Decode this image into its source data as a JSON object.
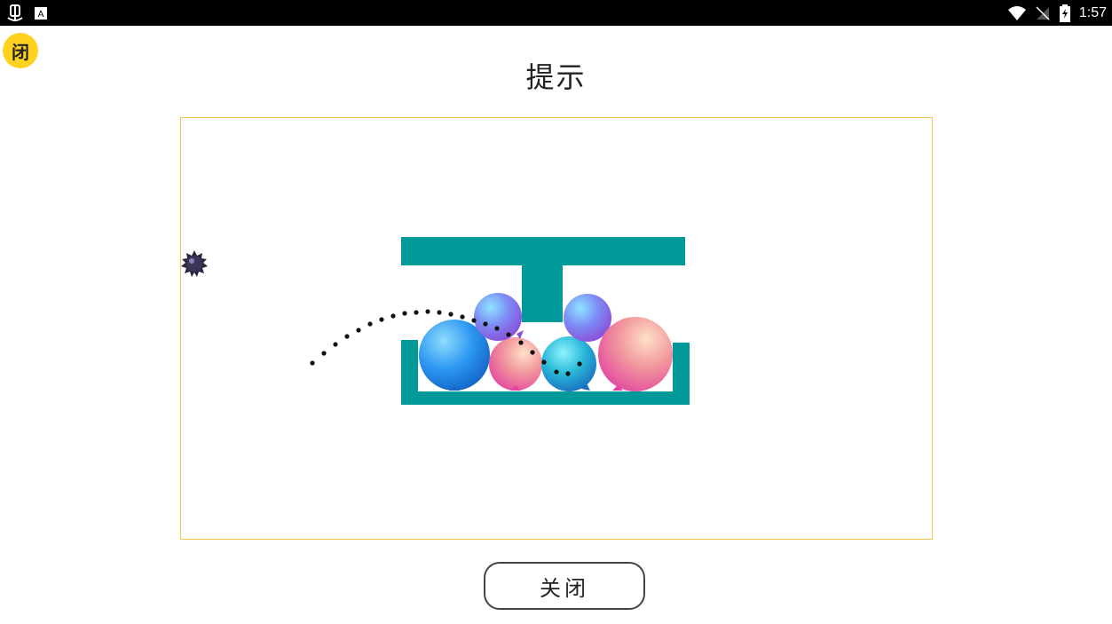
{
  "status_bar": {
    "time": "1:57",
    "left_icons": [
      "bug-icon",
      "a-notification-icon"
    ],
    "right_icons": [
      "wifi-icon",
      "no-signal-icon",
      "battery-charging-icon"
    ]
  },
  "close_badge": {
    "label": "闭",
    "color": "#ffd21e"
  },
  "dialog": {
    "title": "提示",
    "frame_color": "#f3c64a",
    "close_label": "关闭"
  },
  "scene": {
    "structure_color": "#02999a",
    "bomb_icon": "spiked-bomb-icon",
    "trajectory": "dotted-arc",
    "balloons": [
      {
        "name": "balloon-large-blue",
        "color": "blue"
      },
      {
        "name": "balloon-small-purple-top",
        "color": "purple"
      },
      {
        "name": "balloon-pink-small",
        "color": "pink"
      },
      {
        "name": "balloon-cyan",
        "color": "cyan"
      },
      {
        "name": "balloon-purple-right-top",
        "color": "purple"
      },
      {
        "name": "balloon-large-pink",
        "color": "pink"
      }
    ]
  }
}
